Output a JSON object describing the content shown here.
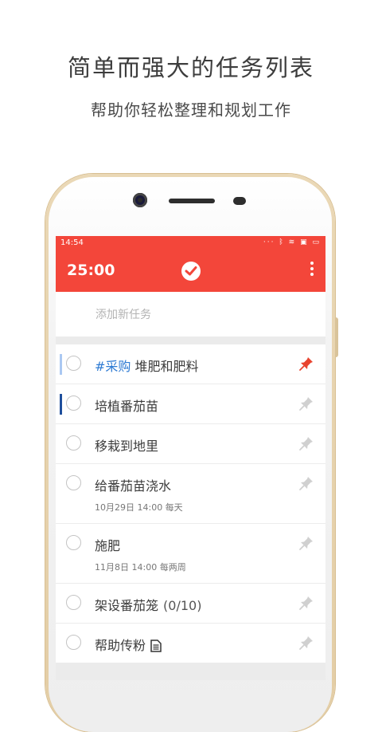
{
  "promo": {
    "headline": "简单而强大的任务列表",
    "subline": "帮助你轻松整理和规划工作"
  },
  "status_bar": {
    "time": "14:54",
    "icons": [
      "dots-icon",
      "bluetooth-icon",
      "wifi-icon",
      "sim-icon",
      "battery-icon"
    ]
  },
  "app_bar": {
    "timer": "25:00",
    "logo_icon": "checkmark-circle-icon",
    "menu_icon": "more-vert-icon",
    "accent_color": "#f3463a"
  },
  "add_task": {
    "placeholder": "添加新任务",
    "value": ""
  },
  "tasks": [
    {
      "tag": "#采购",
      "title": " 堆肥和肥料",
      "pinned": true,
      "bar_color": "#aac8f2"
    },
    {
      "title": "培植番茄苗",
      "pinned": false,
      "bar_color": "#1f4f9c"
    },
    {
      "title": "移栽到地里",
      "pinned": false
    },
    {
      "title": "给番茄苗浇水",
      "subtitle": "10月29日 14:00 每天",
      "pinned": false
    },
    {
      "title": "施肥",
      "subtitle": "11月8日 14:00 每两周",
      "pinned": false
    },
    {
      "title": "架设番茄笼",
      "count": "(0/10)",
      "pinned": false
    },
    {
      "title": "帮助传粉",
      "has_note": true,
      "pinned": false
    }
  ],
  "colors": {
    "tag": "#2f7bd3",
    "pin_active": "#e8442f",
    "pin_inactive": "#d0d0d0"
  }
}
